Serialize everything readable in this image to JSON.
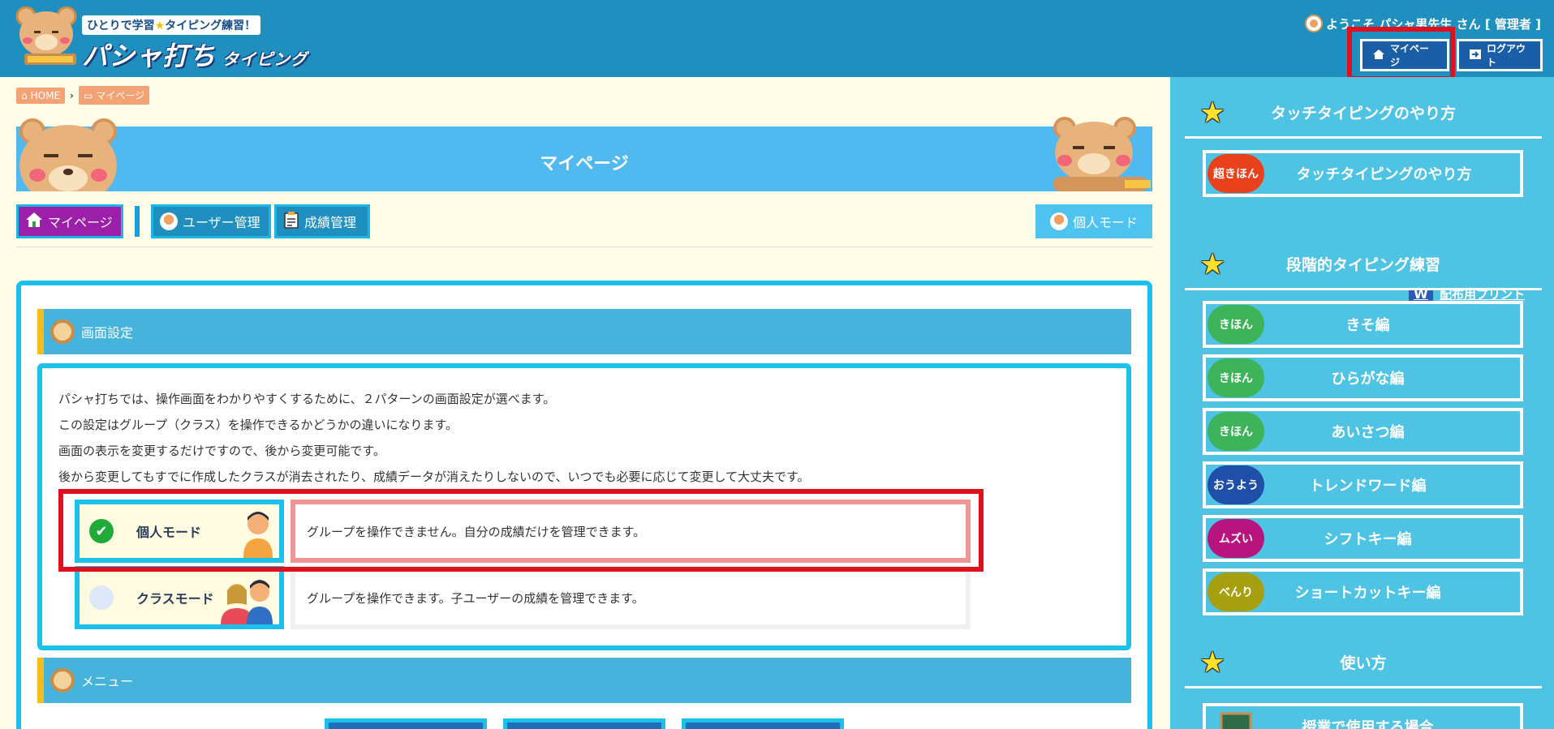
{
  "header": {
    "tagline_pre": "ひとりで学習",
    "tagline_post": "タイピング練習！",
    "logo_main": "パシャ打ち",
    "logo_sub": "タイピング",
    "welcome": "ようこそ パシャ男先生 さん [ 管理者 ]",
    "mypage_label": "マイページ",
    "logout_label": "ログアウト"
  },
  "breadcrumb": {
    "home": "HOME",
    "current": "マイページ"
  },
  "banner": {
    "title": "マイページ"
  },
  "subnav": {
    "mypage": "マイページ",
    "user_mgmt": "ユーザー管理",
    "grade_mgmt": "成績管理",
    "personal_mode": "個人モード"
  },
  "screen_settings": {
    "heading": "画面設定",
    "lines": [
      "パシャ打ちでは、操作画面をわかりやすくするために、２パターンの画面設定が選べます。",
      "この設定はグループ（クラス）を操作できるかどうかの違いになります。",
      "画面の表示を変更するだけですので、後から変更可能です。",
      "後から変更してもすでに作成したクラスが消去されたり、成績データが消えたりしないので、いつでも必要に応じて変更して大丈夫です。"
    ],
    "modes": [
      {
        "label": "個人モード",
        "desc": "グループを操作できません。自分の成績だけを管理できます。",
        "selected": true
      },
      {
        "label": "クラスモード",
        "desc": "グループを操作できます。子ユーザーの成績を管理できます。",
        "selected": false
      }
    ]
  },
  "menu": {
    "heading": "メニュー"
  },
  "sidebar": {
    "sections": [
      {
        "title": "タッチタイピングのやり方",
        "items": [
          {
            "badge": "超きほん",
            "label": "タッチタイピングのやり方",
            "badge_color": "#e8411c"
          }
        ],
        "print_link": "配布用プリント"
      },
      {
        "title": "段階的タイピング練習",
        "items": [
          {
            "badge": "きほん",
            "label": "きそ編",
            "badge_color": "#3db35a"
          },
          {
            "badge": "きほん",
            "label": "ひらがな編",
            "badge_color": "#3db35a"
          },
          {
            "badge": "きほん",
            "label": "あいさつ編",
            "badge_color": "#3db35a"
          },
          {
            "badge": "おうよう",
            "label": "トレンドワード編",
            "badge_color": "#1f4fa8"
          },
          {
            "badge": "ムズい",
            "label": "シフトキー編",
            "badge_color": "#b8147e"
          },
          {
            "badge": "べんり",
            "label": "ショートカットキー編",
            "badge_color": "#a6a010"
          }
        ]
      },
      {
        "title": "使い方",
        "items": [
          {
            "badge": "",
            "label": "授業で使用する場合",
            "badge_color": "#4fc3e3"
          }
        ]
      }
    ]
  },
  "colors": {
    "header_bg": "#1e8fbf",
    "sidebar_bg": "#4fc3e3",
    "banner_bg": "#4fb9f0",
    "highlight_red": "#e0101e",
    "mypage_active": "#9b1fa8"
  }
}
